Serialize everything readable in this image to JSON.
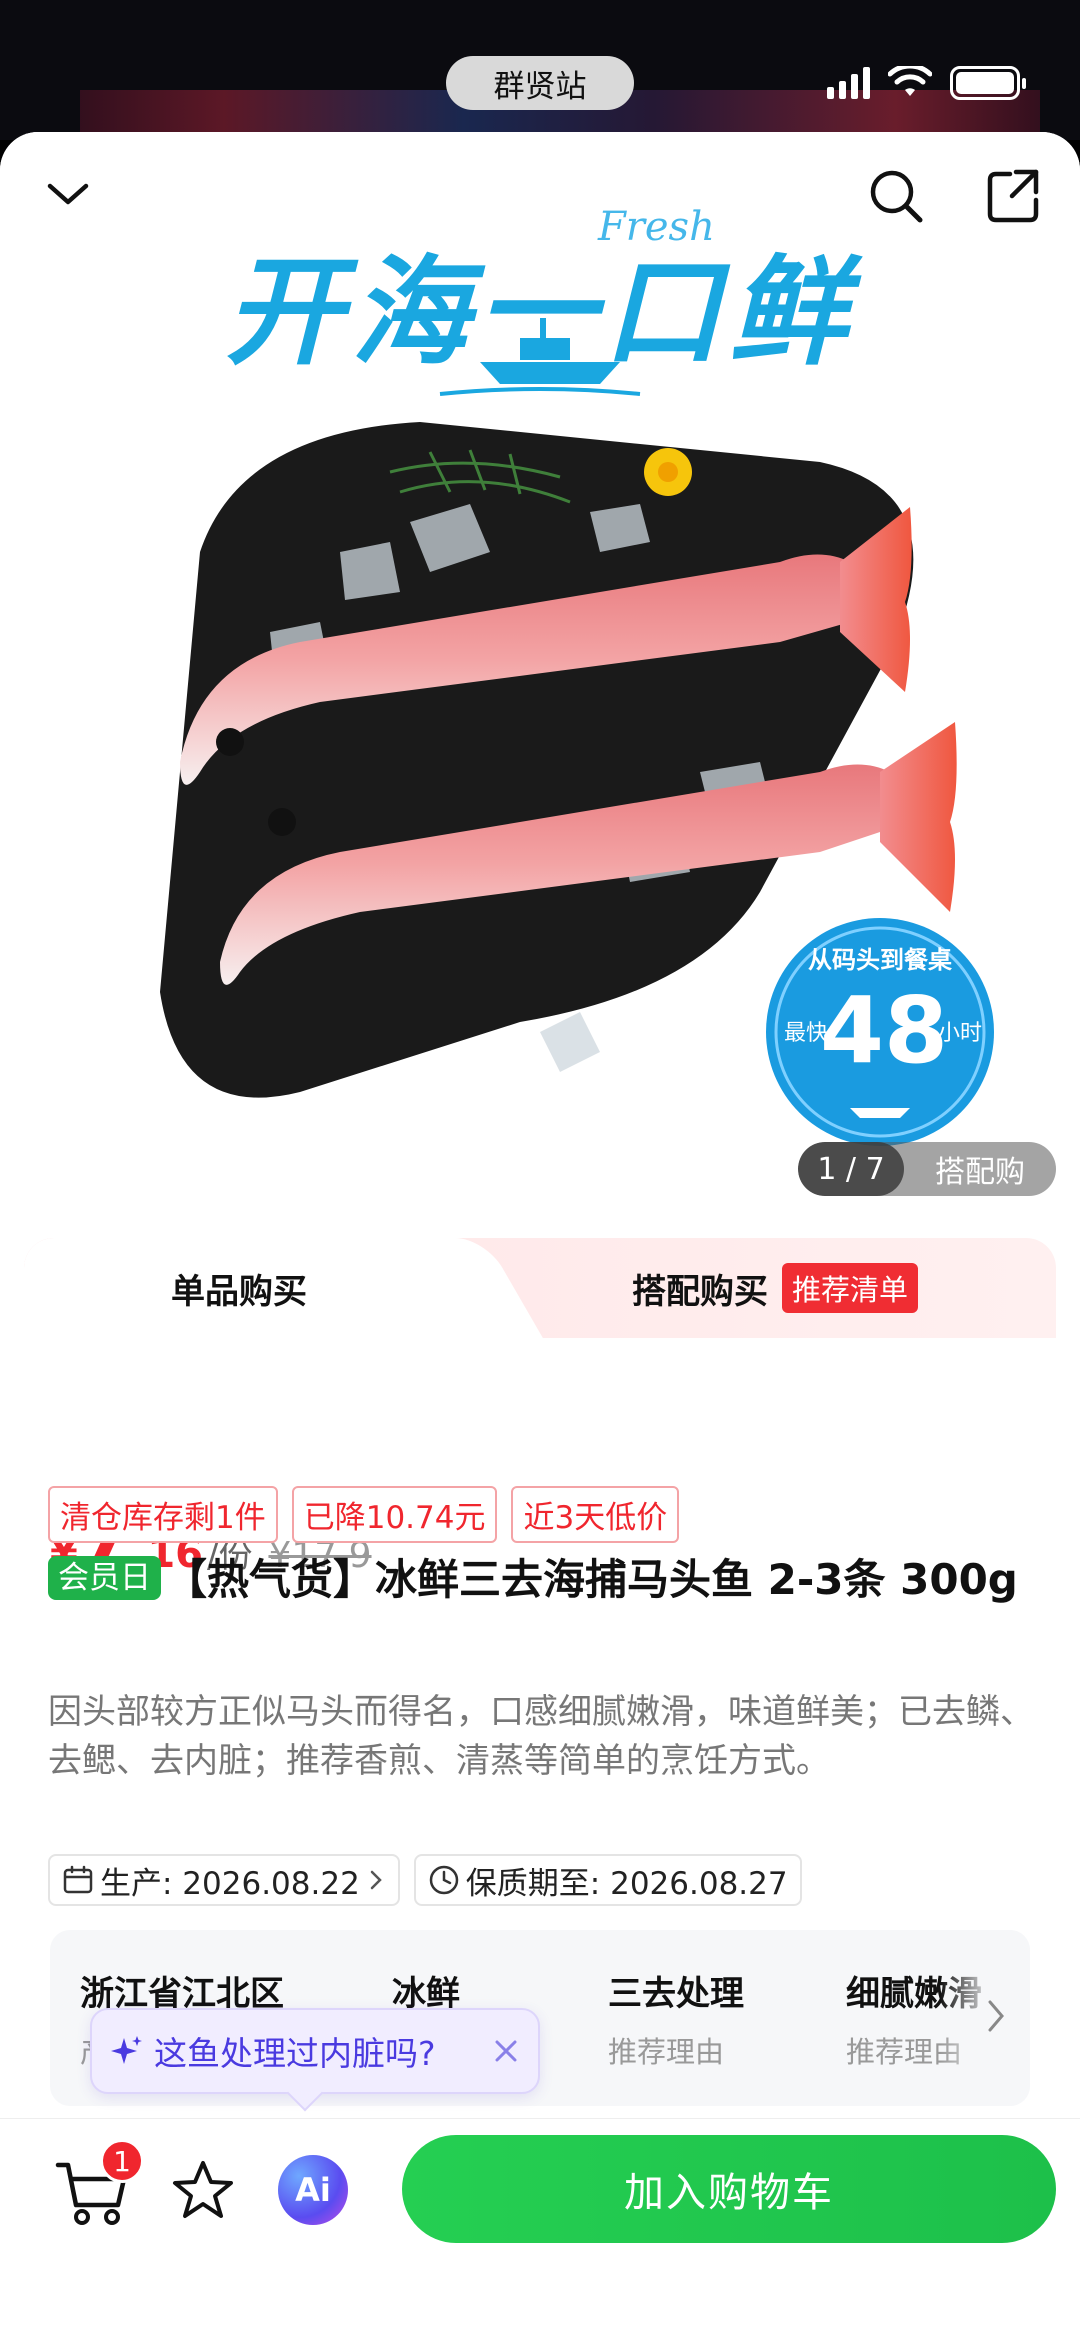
{
  "status_bar": {
    "center_label": "群贤站"
  },
  "hero": {
    "slogan": "开海一口鲜",
    "slogan_accent": "Fresh",
    "badge_top": "从码头到餐桌",
    "badge_left": "最快",
    "badge_number": "48",
    "badge_unit": "小时",
    "photo_counter": "1 / 7",
    "photo_label": "搭配购"
  },
  "tabs": {
    "single": "单品购买",
    "combo": "搭配购买",
    "combo_badge": "推荐清单"
  },
  "price": {
    "symbol": "¥",
    "integer": "7",
    "decimal": ".16",
    "unit": "/份",
    "original": "¥17.9"
  },
  "tags": [
    "清仓库存剩1件",
    "已降10.74元",
    "近3天低价"
  ],
  "product": {
    "member_badge": "会员日",
    "title": "【热气货】冰鲜三去海捕马头鱼 2-3条 300g",
    "description": "因头部较方正似马头而得名，口感细腻嫩滑，味道鲜美；已去鳞、去鳃、去内脏；推荐香煎、清蒸等简单的烹饪方式。"
  },
  "dates": {
    "production": "生产: 2026.08.22",
    "expiry": "保质期至: 2026.08.27"
  },
  "attributes": [
    {
      "value": "浙江省江北区",
      "key": "产地"
    },
    {
      "value": "冰鲜",
      "key": "推荐理由"
    },
    {
      "value": "三去处理",
      "key": "推荐理由"
    },
    {
      "value": "细腻嫩滑",
      "key": "推荐理由"
    }
  ],
  "ai_tip": {
    "text": "这鱼处理过内脏吗?"
  },
  "bottom_bar": {
    "cart_count": "1",
    "ai_label": "Ai",
    "add_to_cart": "加入购物车"
  },
  "colors": {
    "accent_red": "#f0262e",
    "accent_green": "#1fb14a",
    "slogan_blue": "#1aa7e0",
    "ai_purple": "#4a3ae0"
  }
}
